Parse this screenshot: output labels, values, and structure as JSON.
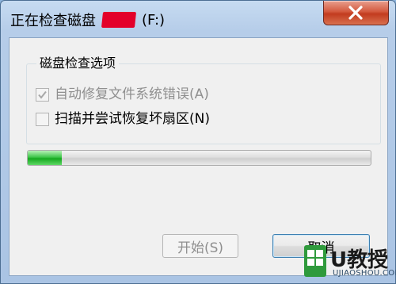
{
  "window": {
    "title_prefix": "正在检查磁盘",
    "title_drive": "(F:)"
  },
  "group": {
    "title": "磁盘检查选项",
    "options": [
      {
        "label": "自动修复文件系统错误(A)",
        "checked": true,
        "enabled": false
      },
      {
        "label": "扫描并尝试恢复坏扇区(N)",
        "checked": false,
        "enabled": false
      }
    ]
  },
  "progress": {
    "fraction": 0.1
  },
  "buttons": {
    "start_label": "开始(S)",
    "cancel_label": "取消"
  },
  "watermark": {
    "brand": "U教授",
    "url": "UJIAOSHOU.COM"
  },
  "colors": {
    "title_bar": "#b6cde9",
    "close_button": "#c8452a",
    "redaction": "#e3002a",
    "progress_fill": "#22b02a",
    "dialog_bg": "#f0f0f0"
  },
  "icons": [
    "close-icon",
    "checkmark-icon",
    "windows-logo-icon"
  ]
}
